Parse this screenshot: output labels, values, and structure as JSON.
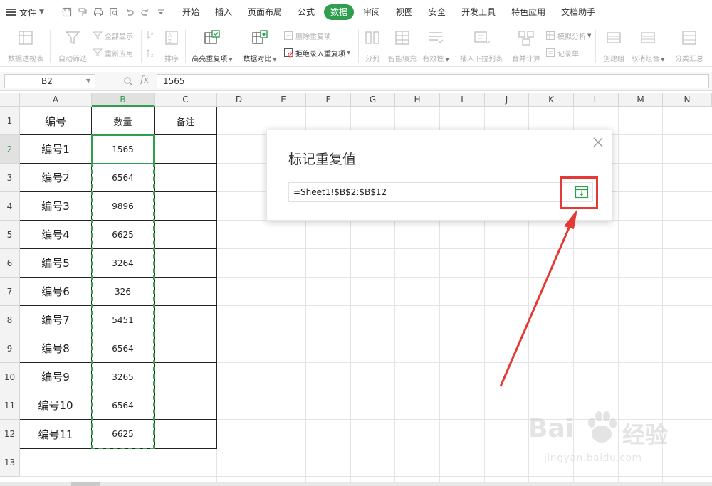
{
  "menubar": {
    "file_label": "文件",
    "tabs": [
      "开始",
      "插入",
      "页面布局",
      "公式",
      "数据",
      "审阅",
      "视图",
      "安全",
      "开发工具",
      "特色应用",
      "文档助手"
    ],
    "active_tab": "数据"
  },
  "ribbon": {
    "pivot_table": "数据透视表",
    "auto_filter": "自动筛选",
    "show_all": "全部显示",
    "reapply": "重新应用",
    "sort": "排序",
    "highlight_duplicates": "高亮重复项",
    "data_compare": "数据对比",
    "remove_duplicates": "删除重复项",
    "reject_duplicates": "拒绝录入重复项",
    "split_column": "分列",
    "smart_fill": "智能填充",
    "validation": "有效性",
    "insert_dropdown": "插入下拉列表",
    "consolidate": "合并计算",
    "what_if": "模拟分析",
    "record_form": "记录单",
    "create_group": "创建组",
    "ungroup": "取消组合",
    "subtotal": "分类汇总"
  },
  "formula_bar": {
    "name_box": "B2",
    "fx": "fx",
    "formula": "1565"
  },
  "grid": {
    "columns": [
      "A",
      "B",
      "C",
      "D",
      "E",
      "F",
      "G",
      "H",
      "I",
      "J",
      "K",
      "L",
      "M",
      "N"
    ],
    "rows": [
      "1",
      "2",
      "3",
      "4",
      "5",
      "6",
      "7",
      "8",
      "9",
      "10",
      "11",
      "12",
      "13"
    ],
    "selected_column": "B",
    "selected_row": "2"
  },
  "table": {
    "headers": [
      "编号",
      "数量",
      "备注"
    ],
    "rows": [
      [
        "编号1",
        "1565",
        ""
      ],
      [
        "编号2",
        "6564",
        ""
      ],
      [
        "编号3",
        "9896",
        ""
      ],
      [
        "编号4",
        "6625",
        ""
      ],
      [
        "编号5",
        "3264",
        ""
      ],
      [
        "编号6",
        "326",
        ""
      ],
      [
        "编号7",
        "5451",
        ""
      ],
      [
        "编号8",
        "6564",
        ""
      ],
      [
        "编号9",
        "3265",
        ""
      ],
      [
        "编号10",
        "6564",
        ""
      ],
      [
        "编号11",
        "6625",
        ""
      ]
    ]
  },
  "dialog": {
    "title": "标记重复值",
    "range_value": "=Sheet1!$B$2:$B$12"
  },
  "watermark": {
    "brand": "Bai",
    "brand_cn": "经验",
    "url": "jingyan.baidu.com"
  },
  "colors": {
    "accent": "#2f9e4f",
    "annotation": "#e53935"
  }
}
